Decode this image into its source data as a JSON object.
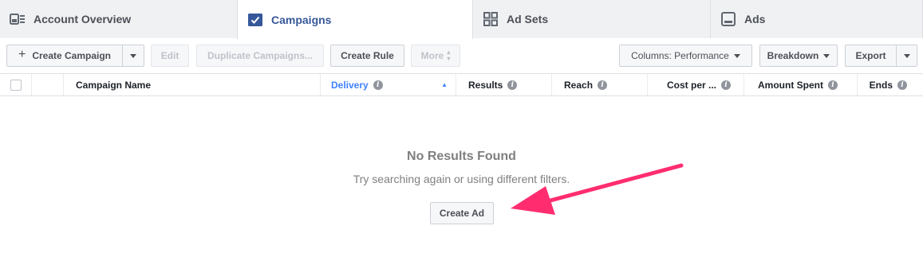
{
  "tabs": {
    "account_overview": "Account Overview",
    "campaigns": "Campaigns",
    "ad_sets": "Ad Sets",
    "ads": "Ads"
  },
  "toolbar": {
    "create_campaign": "Create Campaign",
    "edit": "Edit",
    "duplicate": "Duplicate Campaigns...",
    "create_rule": "Create Rule",
    "more": "More",
    "columns": "Columns: Performance",
    "breakdown": "Breakdown",
    "export": "Export"
  },
  "table": {
    "columns": {
      "campaign_name": "Campaign Name",
      "delivery": "Delivery",
      "results": "Results",
      "reach": "Reach",
      "cost_per": "Cost per ...",
      "amount_spent": "Amount Spent",
      "ends": "Ends"
    },
    "sorted_column": "delivery"
  },
  "empty_state": {
    "title": "No Results Found",
    "subtitle": "Try searching again or using different filters.",
    "create_ad": "Create Ad"
  },
  "colors": {
    "accent_blue": "#365899",
    "sort_blue": "#4080ff",
    "arrow_pink": "#ff2d6f"
  }
}
